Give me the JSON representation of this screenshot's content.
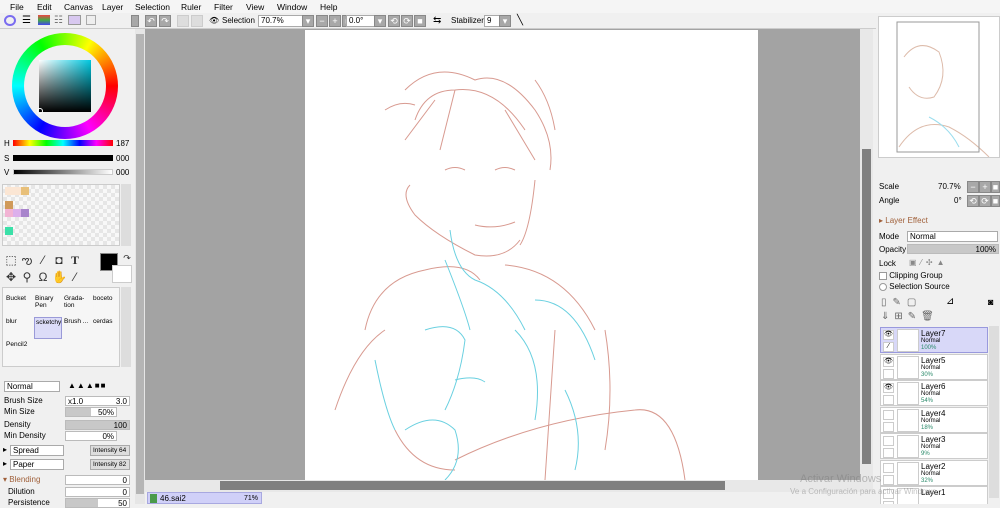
{
  "menu": [
    "File",
    "Edit",
    "Canvas",
    "Layer",
    "Selection",
    "Ruler",
    "Filter",
    "View",
    "Window",
    "Help"
  ],
  "toolbar": {
    "selection_label": "Selection",
    "zoom": "70.7%",
    "angle": "0.0°",
    "stabilizer_label": "Stabilizer",
    "stabilizer_value": "9"
  },
  "color": {
    "h_label": "H",
    "h_value": "187",
    "s_label": "S",
    "s_value": "000",
    "v_label": "V",
    "v_value": "000",
    "swatches": [
      "#fbe6d4",
      "#fbe6d4",
      "#e8c07a",
      "#d09a5a",
      "#f2b4d4",
      "#dcb0ec",
      "#a884cc",
      "#3ae0a8"
    ]
  },
  "brushes": [
    {
      "name": "Bucket"
    },
    {
      "name": "Binary Pen"
    },
    {
      "name": "Grada-tion"
    },
    {
      "name": "boceto"
    },
    {
      "name": "blur"
    },
    {
      "name": "scketchy"
    },
    {
      "name": "Brush ..."
    },
    {
      "name": "cerdas"
    },
    {
      "name": "Pencil2"
    }
  ],
  "brush_settings": {
    "blend_mode": "Normal",
    "brush_size_label": "Brush Size",
    "brush_size_mult": "x1.0",
    "brush_size": "3.0",
    "min_size_label": "Min Size",
    "min_size": "50%",
    "density_label": "Density",
    "density": "100",
    "min_density_label": "Min Density",
    "min_density": "0%",
    "spread_label": "Spread",
    "spread_intensity": "Intensity 64",
    "paper_label": "Paper",
    "paper_intensity": "Intensity 82",
    "blending_label": "Blending",
    "blending": "0",
    "dilution_label": "Dilution",
    "dilution": "0",
    "persistence_label": "Persistence",
    "persistence": "50"
  },
  "navigator": {
    "scale_label": "Scale",
    "scale": "70.7%",
    "angle_label": "Angle",
    "angle": "0°"
  },
  "layer_panel": {
    "layer_effect": "Layer Effect",
    "mode_label": "Mode",
    "mode": "Normal",
    "opacity_label": "Opacity",
    "opacity": "100%",
    "lock_label": "Lock",
    "clipping_group": "Clipping Group",
    "selection_source": "Selection Source",
    "layers": [
      {
        "name": "Layer7",
        "mode": "Normal",
        "opacity": "100%",
        "visible": true,
        "selected": true
      },
      {
        "name": "Layer5",
        "mode": "Normal",
        "opacity": "30%",
        "visible": true,
        "selected": false
      },
      {
        "name": "Layer6",
        "mode": "Normal",
        "opacity": "54%",
        "visible": true,
        "selected": false
      },
      {
        "name": "Layer4",
        "mode": "Normal",
        "opacity": "18%",
        "visible": false,
        "selected": false
      },
      {
        "name": "Layer3",
        "mode": "Normal",
        "opacity": "9%",
        "visible": false,
        "selected": false
      },
      {
        "name": "Layer2",
        "mode": "Normal",
        "opacity": "32%",
        "visible": false,
        "selected": false
      },
      {
        "name": "Layer1",
        "mode": "",
        "opacity": "",
        "visible": false,
        "selected": false
      }
    ]
  },
  "document_tab": {
    "name": "46.sai2",
    "zoom": "71%"
  },
  "watermark": {
    "line1": "Activar Windows",
    "line2": "Ve a Configuración para activar Windows."
  }
}
